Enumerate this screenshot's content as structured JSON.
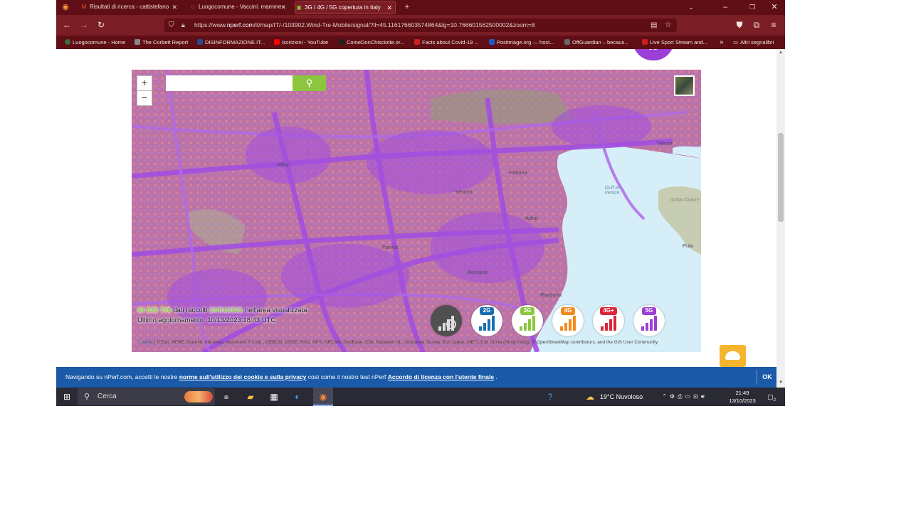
{
  "browser": {
    "tabs": [
      {
        "label": "Risultati di ricerca - cattistefano",
        "icon": "gmail-icon",
        "active": false
      },
      {
        "label": "Luogocomune - Vaccini: mamme",
        "icon": "page-icon",
        "active": false
      },
      {
        "label": "3G / 4G / 5G copertura in Italy",
        "icon": "nperf-icon",
        "active": true
      }
    ],
    "new_tab": "+",
    "url_prefix": "https://www.",
    "url_host": "nperf.com",
    "url_rest": "/it/map/IT/-/103902.Wind-Tre-Mobile/signal/?ll=45.116176603574864&lg=10.766601562500002&zoom=8"
  },
  "bookmarks": [
    {
      "label": "Luogocomune - Home",
      "color": "#3b6b3b"
    },
    {
      "label": "The Corbett Report",
      "color": "#555555"
    },
    {
      "label": "DISINFORMAZIONE.IT...",
      "color": "#2a4a8a"
    },
    {
      "label": "Iscrizioni - YouTube",
      "color": "#ff0000"
    },
    {
      "label": "ComeDonChisciotte.or...",
      "color": "#333333"
    },
    {
      "label": "Facts about Covid-19 ...",
      "color": "#cc2222"
    },
    {
      "label": "Postimage.org — host...",
      "color": "#1e5ac8"
    },
    {
      "label": "OffGuardian – becaus...",
      "color": "#444444"
    },
    {
      "label": "Live Sport Stream and...",
      "color": "#c81e1e"
    }
  ],
  "bookmarks_more": "»",
  "bookmarks_other": "Altri segnalibri",
  "map": {
    "zoom_in": "+",
    "zoom_out": "−",
    "search_placeholder": "",
    "cities": [
      "Milan",
      "Verona",
      "Padova",
      "Trieste",
      "Pula",
      "Parma",
      "Bologna",
      "Ravenna",
      "Adria",
      "Gulf of Venice",
      "ISTRA COUNTY"
    ],
    "stats_count": "64 826 796",
    "stats_mid": "dati raccolti",
    "stats_date": "10/01/2021",
    "stats_end": "nell'area visualizzata.",
    "stats_updated": "Ultimo aggiornamento: 10/13/2023 18:43 UTC",
    "tech_filters": [
      {
        "label": "",
        "color": "#505050"
      },
      {
        "label": "2G",
        "color": "#1a6fb0"
      },
      {
        "label": "3G",
        "color": "#8cc63f"
      },
      {
        "label": "4G",
        "color": "#f38a1d"
      },
      {
        "label": "4G+",
        "color": "#d9263a"
      },
      {
        "label": "5G",
        "color": "#9b3fd6"
      }
    ],
    "attribution_link": "Leaflet",
    "attribution": " | © Esri, HERE, Garmin, Intermap, increment P Corp., GEBCO, USGS, FAO, NPS, NRCAN, GeoBase, IGN, Kadaster NL, Ordnance Survey, Esri Japan, METI, Esri China (Hong Kong), © OpenStreetMap contributors, and the GIS User Community"
  },
  "cookie": {
    "text1": "Navigando su nPerf.com, accetti le nostre ",
    "link1": "norme sull'utilizzo dei cookie e sulla privacy",
    "text2": " così come il nostro test nPerf ",
    "link2": "Accordo di licenza con l'utente finale",
    "text3": " .",
    "ok": "OK"
  },
  "taskbar": {
    "search_placeholder": "Cerca",
    "weather": "19°C  Nuvoloso",
    "time": "21:49",
    "date": "13/10/2023",
    "notifications": "2"
  }
}
